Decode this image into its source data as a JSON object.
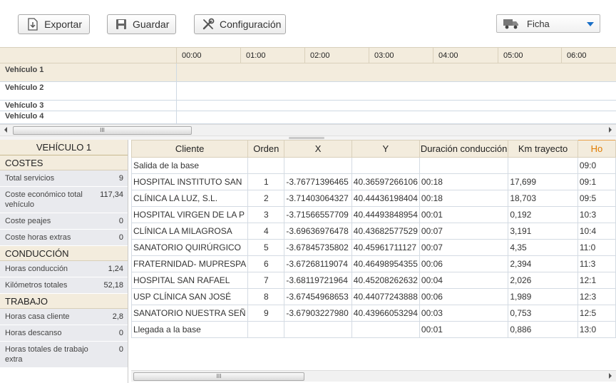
{
  "toolbar": {
    "export_label": "Exportar",
    "save_label": "Guardar",
    "config_label": "Configuración",
    "view_select": "Ficha"
  },
  "timeline": {
    "hours": [
      "00:00",
      "01:00",
      "02:00",
      "03:00",
      "04:00",
      "05:00",
      "06:00"
    ],
    "vehicles": [
      "Vehículo 1",
      "Vehículo 2",
      "Vehículo 3",
      "Vehículo 4"
    ]
  },
  "scroll_grip": "III",
  "panel": {
    "title": "VEHÍCULO 1",
    "sections": [
      {
        "title": "COSTES",
        "rows": [
          {
            "label": "Total servicios",
            "value": "9"
          },
          {
            "label": "Coste económico total vehículo",
            "value": "117,34"
          },
          {
            "label": "Coste peajes",
            "value": "0"
          },
          {
            "label": "Coste horas extras",
            "value": "0"
          }
        ]
      },
      {
        "title": "CONDUCCIÓN",
        "rows": [
          {
            "label": "Horas conducción",
            "value": "1,24"
          },
          {
            "label": "Kilómetros totales",
            "value": "52,18"
          }
        ]
      },
      {
        "title": "TRABAJO",
        "rows": [
          {
            "label": "Horas casa cliente",
            "value": "2,8"
          },
          {
            "label": "Horas descanso",
            "value": "0"
          },
          {
            "label": "Horas totales de trabajo extra",
            "value": "0"
          }
        ]
      }
    ]
  },
  "table": {
    "columns": [
      "Cliente",
      "Orden",
      "X",
      "Y",
      "Duración conducción",
      "Km trayecto",
      "Ho"
    ],
    "rows": [
      [
        "Salida de la base",
        "",
        "",
        "",
        "",
        "",
        "09:0"
      ],
      [
        "HOSPITAL INSTITUTO SAN",
        "1",
        "-3.76771396465",
        "40.36597266106",
        "00:18",
        "17,699",
        "09:1"
      ],
      [
        "CLÍNICA LA LUZ, S.L.",
        "2",
        "-3.71403064327",
        "40.44436198404",
        "00:18",
        "18,703",
        "09:5"
      ],
      [
        "HOSPITAL VIRGEN DE LA P",
        "3",
        "-3.71566557709",
        "40.44493848954",
        "00:01",
        "0,192",
        "10:3"
      ],
      [
        "CLÍNICA LA MILAGROSA",
        "4",
        "-3.69636976478",
        "40.43682577529",
        "00:07",
        "3,191",
        "10:4"
      ],
      [
        "SANATORIO QUIRÚRGICO",
        "5",
        "-3.67845735802",
        "40.45961711127",
        "00:07",
        "4,35",
        "11:0"
      ],
      [
        "FRATERNIDAD- MUPRESPA",
        "6",
        "-3.67268119074",
        "40.46498954355",
        "00:06",
        "2,394",
        "11:3"
      ],
      [
        "HOSPITAL SAN RAFAEL",
        "7",
        "-3.68119721964",
        "40.45208262632",
        "00:04",
        "2,026",
        "12:1"
      ],
      [
        "USP CLÍNICA SAN JOSÉ",
        "8",
        "-3.67454968653",
        "40.44077243888",
        "00:06",
        "1,989",
        "12:3"
      ],
      [
        "SANATORIO NUESTRA SEÑ",
        "9",
        "-3.67903227980",
        "40.43966053294",
        "00:03",
        "0,753",
        "12:5"
      ],
      [
        "Llegada a la base",
        "",
        "",
        "",
        "00:01",
        "0,886",
        "13:0"
      ]
    ]
  }
}
